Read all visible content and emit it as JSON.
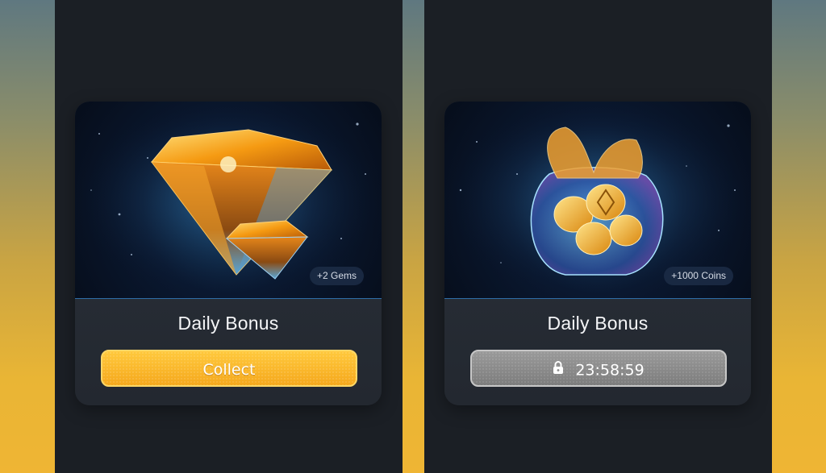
{
  "cards": [
    {
      "reward_badge": "+2 Gems",
      "title": "Daily Bonus",
      "button_label": "Collect",
      "button_state": "active",
      "art_icon": "gems-icon"
    },
    {
      "reward_badge": "+1000 Coins",
      "title": "Daily Bonus",
      "button_label": "23:58:59",
      "button_state": "locked",
      "art_icon": "coin-bag-icon",
      "button_icon": "lock-icon"
    }
  ],
  "colors": {
    "collect_button": "#f5a81c",
    "locked_button": "#8a8a8a",
    "panel_background": "#1b1f25",
    "card_background": "#2b323b"
  }
}
